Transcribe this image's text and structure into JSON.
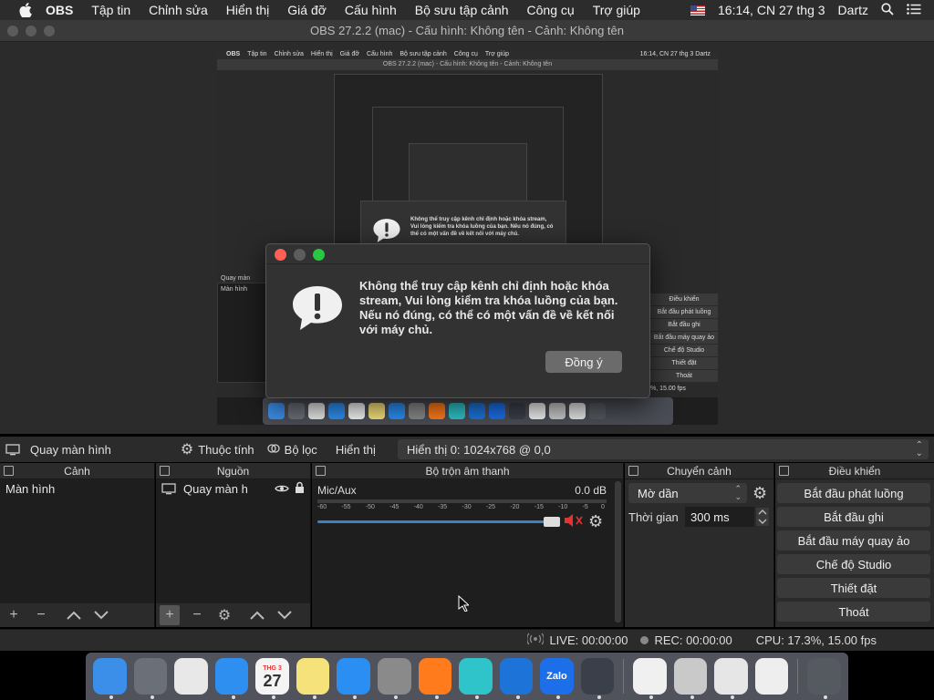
{
  "menubar": {
    "app": "OBS",
    "items": [
      "Tập tin",
      "Chỉnh sửa",
      "Hiển thị",
      "Giá đỡ",
      "Cấu hình",
      "Bộ sưu tập cảnh",
      "Công cụ",
      "Trợ giúp"
    ],
    "clock": "16:14, CN 27 thg 3",
    "user": "Dartz"
  },
  "window": {
    "title": "OBS 27.2.2 (mac) - Cấu hình: Không tên - Cảnh: Không tên"
  },
  "preview_mini": {
    "menubar_app": "OBS",
    "menubar_items": [
      "Tập tin",
      "Chỉnh sửa",
      "Hiển thị",
      "Giá đỡ",
      "Cấu hình",
      "Bộ sưu tập cảnh",
      "Công cụ",
      "Trợ giúp"
    ],
    "menubar_right": "16:14, CN 27 thg 3  Dartz",
    "title": "OBS 27.2.2 (mac) - Cấu hình: Không tên - Cảnh: Không tên",
    "source_label": "Quay màn",
    "scene_item": "Màn hình",
    "controls": [
      "Điều khiển",
      "Bắt đầu phát luồng",
      "Bắt đầu ghi",
      "Bắt đầu máy quay ảo",
      "Chế độ Studio",
      "Thiết đặt",
      "Thoát"
    ],
    "fps": "%, 15.00 fps",
    "nested_message": "Không thể truy cập kênh chỉ định hoặc khóa stream, Vui lòng kiểm tra khóa luồng của bạn. Nếu nó đúng, có thể có một vấn đề về kết nối với máy chủ."
  },
  "dialog": {
    "message": "Không thể truy cập kênh chỉ định hoặc khóa stream, Vui lòng kiểm tra khóa luồng của bạn. Nếu nó đúng, có thể có một vấn đề về kết nối với máy chủ.",
    "ok_label": "Đồng ý"
  },
  "toolbar": {
    "source_name": "Quay màn hình",
    "properties": "Thuộc tính",
    "filters": "Bộ lọc",
    "display_label": "Hiển thị",
    "display_value": "Hiển thị 0: 1024x768 @ 0,0"
  },
  "docks": {
    "scenes": {
      "title": "Cảnh",
      "items": [
        "Màn hình"
      ]
    },
    "sources": {
      "title": "Nguồn",
      "items": [
        "Quay màn h"
      ]
    },
    "mixer": {
      "title": "Bộ trộn âm thanh",
      "channel": "Mic/Aux",
      "db": "0.0 dB",
      "ticks": [
        "-60",
        "-55",
        "-50",
        "-45",
        "-40",
        "-35",
        "-30",
        "-25",
        "-20",
        "-15",
        "-10",
        "-5",
        "0"
      ],
      "volume": 1.0
    },
    "transitions": {
      "title": "Chuyển cảnh",
      "type": "Mờ dần",
      "duration_label": "Thời gian",
      "duration_value": "300 ms"
    },
    "controls": {
      "title": "Điều khiển",
      "buttons": [
        "Bắt đầu phát luồng",
        "Bắt đầu ghi",
        "Bắt đầu máy quay ảo",
        "Chế độ Studio",
        "Thiết đặt",
        "Thoát"
      ]
    }
  },
  "status": {
    "live": "LIVE: 00:00:00",
    "rec": "REC: 00:00:00",
    "cpu": "CPU: 17.3%, 15.00 fps"
  },
  "dock_apps": [
    {
      "name": "Finder",
      "color": "#3b8fe8"
    },
    {
      "name": "Launchpad",
      "color": "#6b6f78"
    },
    {
      "name": "Chrome",
      "color": "#e8e8e8"
    },
    {
      "name": "Safari",
      "color": "#2f8ff0"
    },
    {
      "name": "Calendar",
      "color": "#f4f4f4"
    },
    {
      "name": "Notes",
      "color": "#f6e27a"
    },
    {
      "name": "App Store",
      "color": "#2b8ef2"
    },
    {
      "name": "System Preferences",
      "color": "#8a8a8a"
    },
    {
      "name": "Firefox",
      "color": "#ff7b1c"
    },
    {
      "name": "Krisp",
      "color": "#2ec4c9"
    },
    {
      "name": "Malwarebytes",
      "color": "#1e73d8"
    },
    {
      "name": "Zalo",
      "color": "#1c6fe8"
    },
    {
      "name": "OBS",
      "color": "#3b3f4a"
    },
    {
      "name": "Photos",
      "color": "#f0f0f0"
    },
    {
      "name": "Preview",
      "color": "#c9c9c9"
    },
    {
      "name": "Mail",
      "color": "#e6e6e6"
    },
    {
      "name": "Chrome Apps",
      "color": "#eeeeee"
    },
    {
      "name": "Trash",
      "color": "#555960"
    }
  ],
  "calendar": {
    "month": "THG 3",
    "day": "27"
  },
  "zalo_label": "Zalo",
  "colors": {
    "accent": "#3b82c4",
    "mute": "#e63232",
    "close": "#fe5f57",
    "min": "#febc2e",
    "max": "#28c840"
  }
}
